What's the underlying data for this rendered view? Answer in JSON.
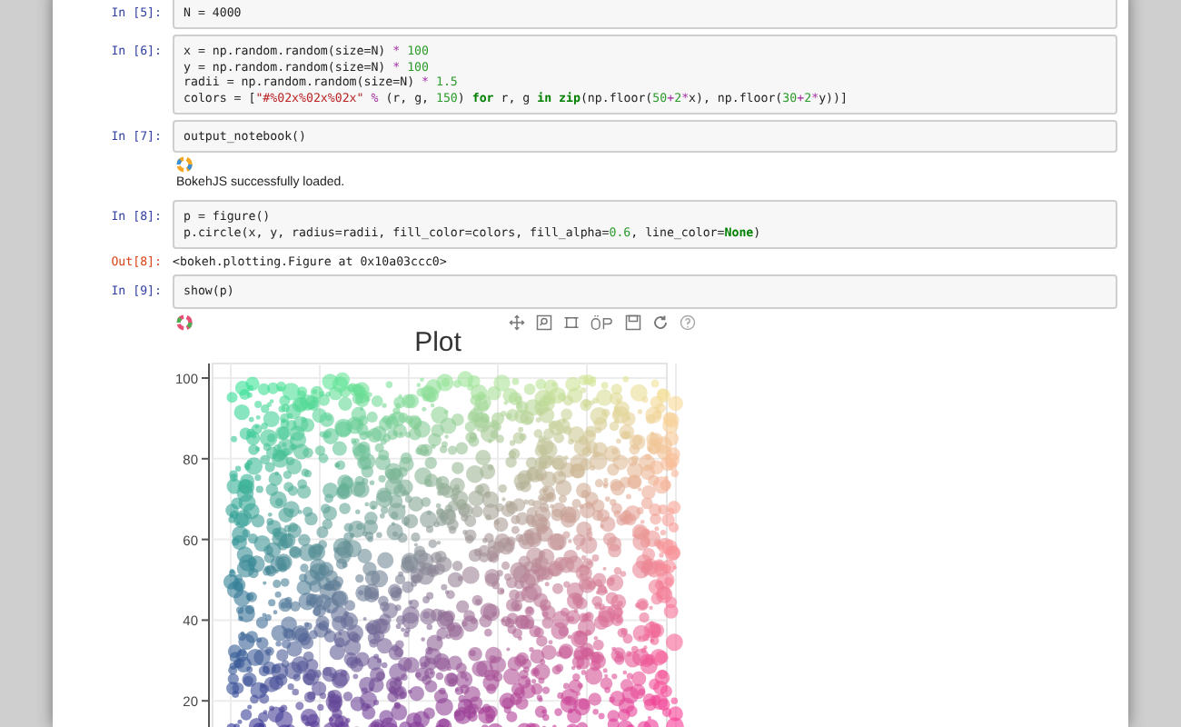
{
  "cells": [
    {
      "kind": "input",
      "prompt": "In [5]:",
      "lines": [
        [
          {
            "kind": "code",
            "text": "N = 4000"
          }
        ]
      ]
    },
    {
      "kind": "input",
      "prompt": "In [6]:",
      "lines": [
        [
          {
            "kind": "code",
            "text": "x = np.random.random(size=N) "
          },
          {
            "kind": "op",
            "text": "* "
          },
          {
            "kind": "num",
            "text": "100"
          }
        ],
        [
          {
            "kind": "code",
            "text": "y = np.random.random(size=N) "
          },
          {
            "kind": "op",
            "text": "* "
          },
          {
            "kind": "num",
            "text": "100"
          }
        ],
        [
          {
            "kind": "code",
            "text": "radii = np.random.random(size=N) "
          },
          {
            "kind": "op",
            "text": "* "
          },
          {
            "kind": "num",
            "text": "1.5"
          }
        ],
        [
          {
            "kind": "code",
            "text": "colors = ["
          },
          {
            "kind": "str",
            "text": "\"#%02x%02x%02x\" "
          },
          {
            "kind": "op",
            "text": "%"
          },
          {
            "kind": "code",
            "text": " (r, g, "
          },
          {
            "kind": "num",
            "text": "150"
          },
          {
            "kind": "code",
            "text": ") "
          },
          {
            "kind": "kw",
            "text": "for"
          },
          {
            "kind": "code",
            "text": " r, g "
          },
          {
            "kind": "kw",
            "text": "in zip"
          },
          {
            "kind": "code",
            "text": "(np.floor("
          },
          {
            "kind": "num",
            "text": "50"
          },
          {
            "kind": "op",
            "text": "+"
          },
          {
            "kind": "num",
            "text": "2"
          },
          {
            "kind": "op",
            "text": "*"
          },
          {
            "kind": "code",
            "text": "x), np.floor("
          },
          {
            "kind": "num",
            "text": "30"
          },
          {
            "kind": "op",
            "text": "+"
          },
          {
            "kind": "num",
            "text": "2"
          },
          {
            "kind": "op",
            "text": "*"
          },
          {
            "kind": "code",
            "text": "y))]"
          }
        ]
      ]
    },
    {
      "kind": "input",
      "prompt": "In [7]:",
      "lines": [
        [
          {
            "kind": "code",
            "text": "output_notebook()"
          }
        ]
      ]
    },
    {
      "kind": "loaded",
      "text": "BokehJS successfully loaded."
    },
    {
      "kind": "input",
      "prompt": "In [8]:",
      "lines": [
        [
          {
            "kind": "code",
            "text": "p = figure()"
          }
        ],
        [
          {
            "kind": "code",
            "text": "p.circle(x, y, radius=radii, fill_color=colors, fill_alpha="
          },
          {
            "kind": "num",
            "text": "0.6"
          },
          {
            "kind": "code",
            "text": ", line_color="
          },
          {
            "kind": "kw",
            "text": "None"
          },
          {
            "kind": "code",
            "text": ")"
          }
        ]
      ]
    },
    {
      "kind": "output",
      "prompt": "Out[8]:",
      "text": "<bokeh.plotting.Figure at 0x10a03ccc0>"
    },
    {
      "kind": "input",
      "prompt": "In [9]:",
      "lines": [
        [
          {
            "kind": "code",
            "text": "show(p)"
          }
        ]
      ]
    },
    {
      "kind": "plot",
      "title": "Plot",
      "yticks": [
        "100",
        "80",
        "60",
        "40",
        "20"
      ]
    }
  ]
}
